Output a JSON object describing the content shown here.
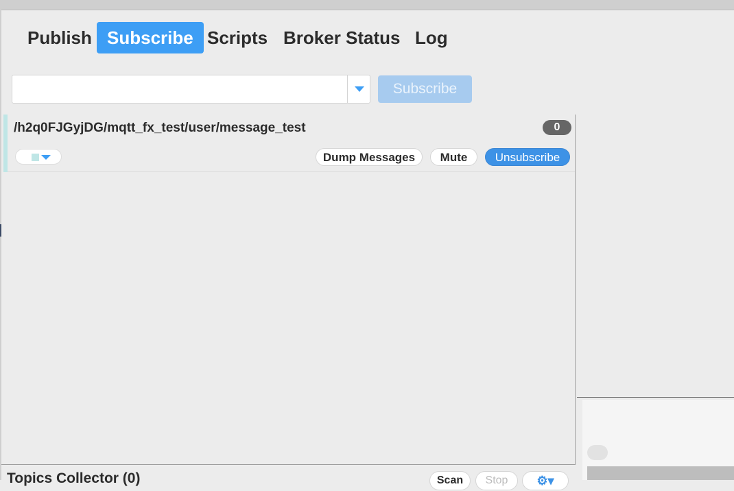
{
  "tabs": [
    {
      "label": "Publish"
    },
    {
      "label": "Subscribe"
    },
    {
      "label": "Scripts"
    },
    {
      "label": "Broker Status"
    },
    {
      "label": "Log"
    }
  ],
  "active_tab": "Subscribe",
  "topic_input": {
    "value": "",
    "placeholder": ""
  },
  "subscribe_button": {
    "label": "Subscribe"
  },
  "subscription": {
    "topic": "/h2q0FJGyjDG/mqtt_fx_test/user/message_test",
    "message_count": "0",
    "color": "#bfe6e6",
    "dump_label": "Dump Messages",
    "mute_label": "Mute",
    "unsubscribe_label": "Unsubscribe"
  },
  "topics_collector": {
    "title": "Topics Collector (0)",
    "scan_label": "Scan",
    "stop_label": "Stop"
  },
  "colors": {
    "accent": "#3d9ef5",
    "background": "#ececec"
  },
  "icons": {
    "combo_arrow": "chevron-down-icon",
    "settings": "gear-icon"
  }
}
